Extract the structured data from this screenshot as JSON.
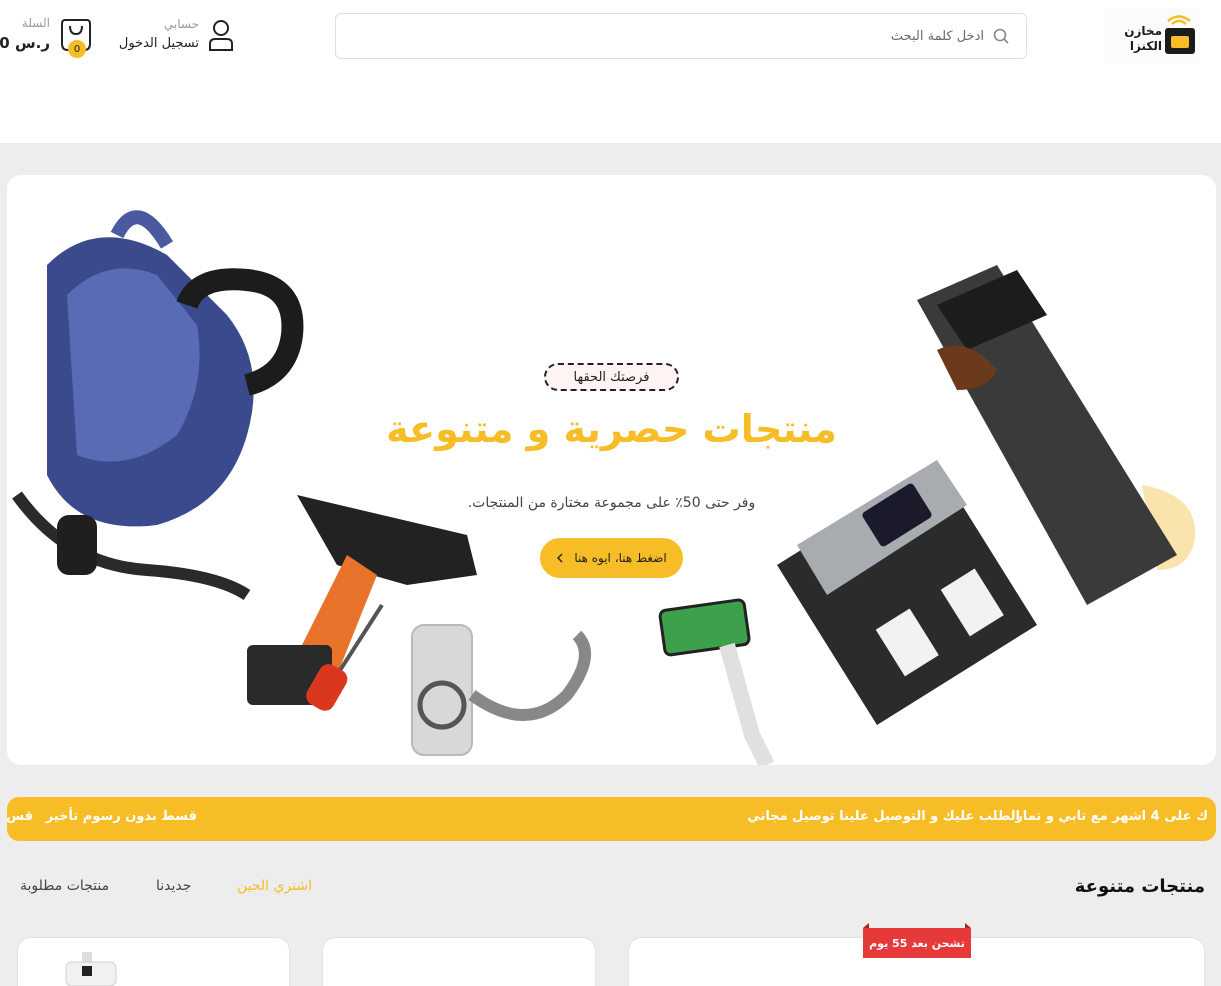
{
  "header": {
    "logo": {
      "line1": "مخازن",
      "line2": "الكنزا",
      "icon": "store-logo-icon"
    },
    "search": {
      "placeholder": "ادخل كلمة البحث",
      "value": "",
      "icon": "search-icon"
    },
    "account": {
      "label": "حسابي",
      "login": "تسجيل الدخول",
      "icon": "user-icon"
    },
    "cart": {
      "label": "السلة",
      "total": "0 ر.س",
      "count": "0",
      "icon": "shopping-bag-icon"
    }
  },
  "hero": {
    "tag": "فرصتك الحقها",
    "title": "منتجات حصرية و متنوعة",
    "subtitle": "وفر حتى 50٪ على مجموعة مختارة من المنتجات.",
    "cta": "اضغط هنا، ايوه هنا",
    "cta_icon": "chevron-left-icon"
  },
  "marquee": {
    "items": [
      "ك على 4 اشهر مع تابي و تمار",
      "الطلب عليك و التوصيل علينا توصيل مجاني",
      "قسط بدون رسوم تأخير",
      "قس"
    ]
  },
  "products_section": {
    "title": "منتجات متنوعة",
    "tabs": [
      {
        "label": "اشتري الحين",
        "active": true
      },
      {
        "label": "جديدنا",
        "active": false
      },
      {
        "label": "منتجات مطلوبة",
        "active": false
      }
    ],
    "shipping_badge": "تشحن بعد 55 يوم"
  },
  "colors": {
    "accent": "#f6bd26",
    "badge_red": "#e63a3a",
    "page_bg": "#ededed"
  }
}
